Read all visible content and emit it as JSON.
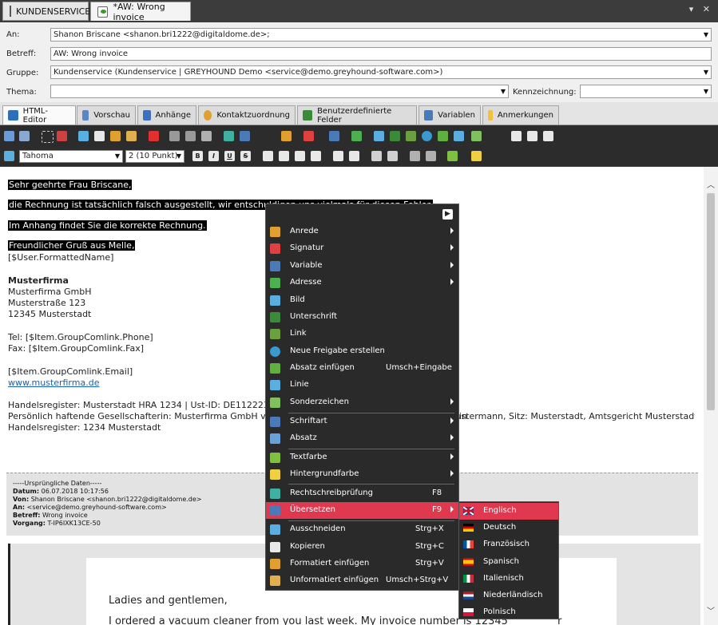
{
  "window": {
    "tabs": [
      {
        "label": "KUNDENSERVICE",
        "icon": "grid-icon"
      },
      {
        "label": "*AW: Wrong invoice",
        "icon": "email-icon"
      }
    ]
  },
  "form": {
    "an_label": "An:",
    "an_value": "Shanon Briscane <shanon.bri1222@digitaldome.de>;",
    "betreff_label": "Betreff:",
    "betreff_value": "AW: Wrong invoice",
    "gruppe_label": "Gruppe:",
    "gruppe_value": "Kundenservice (Kundenservice | GREYHOUND Demo <service@demo.greyhound-software.com>)",
    "thema_label": "Thema:",
    "thema_value": "",
    "kennz_label": "Kennzeichnung:",
    "kennz_value": ""
  },
  "ribbon_tabs": [
    {
      "label": "HTML-Editor",
      "icon": "html-editor-icon",
      "color": "#2f6fb7"
    },
    {
      "label": "Vorschau",
      "icon": "preview-icon",
      "color": "#5a86c5"
    },
    {
      "label": "Anhänge",
      "icon": "paperclip-icon",
      "color": "#3f6fbf"
    },
    {
      "label": "Kontaktzuordnung",
      "icon": "contact-icon",
      "color": "#e0a030"
    },
    {
      "label": "Benutzerdefinierte Felder",
      "icon": "custom-fields-icon",
      "color": "#3a8a3a"
    },
    {
      "label": "Variablen",
      "icon": "variables-icon",
      "color": "#4a7ab8"
    },
    {
      "label": "Anmerkungen",
      "icon": "notes-icon",
      "color": "#f0c040"
    }
  ],
  "toolbar": {
    "font_name": "Tahoma",
    "font_size": "2 (10 Punkt)",
    "format_buttons": [
      "B",
      "I",
      "U",
      "S"
    ]
  },
  "editor": {
    "lines": [
      {
        "text": "Sehr geehrte Frau Briscane,",
        "highlight": true
      },
      {
        "text": "die Rechnung ist tatsächlich falsch ausgestellt, wir entschuldigen uns vielmals für diesen Fehler.",
        "highlight": true
      },
      {
        "text": "Im Anhang findet Sie die korrekte Rechnung.",
        "highlight": true
      },
      {
        "text": "Freundlicher Gruß aus Melle,",
        "highlight": true
      },
      {
        "text": "[$User.FormattedName]",
        "highlight": false
      },
      {
        "text": "Musterfirma",
        "highlight": false,
        "bold": true
      },
      {
        "text": "Musterfirma GmbH",
        "highlight": false
      },
      {
        "text": "Musterstraße 123",
        "highlight": false
      },
      {
        "text": "12345 Musterstadt",
        "highlight": false
      },
      {
        "text": "Tel: [$Item.GroupComlink.Phone]",
        "highlight": false
      },
      {
        "text": "Fax: [$Item.GroupComlink.Fax]",
        "highlight": false
      },
      {
        "text": "[$Item.GroupComlink.Email]",
        "highlight": false
      },
      {
        "text": "www.musterfirma.de",
        "highlight": false,
        "link": true
      },
      {
        "text": "Handelsregister: Musterstadt HRA 1234 | Ust-ID: DE112223333",
        "highlight": false
      },
      {
        "text": "Persönlich haftende Gesellschafterin: Musterfirma GmbH vertreten durch den Geschäftsführer: Max Mustermann, Sitz: Musterstadt, Amtsgericht Musterstadt: Musterstadt, Amtsgericht Musterstadt HRB 1234, Sitz: Musterstadt, Amtsgericht Musterstadt Musterstadt, Amtsgericht Musterstadt HRB 1234, Sitz: Musterstadt, Amtsgericht Musterstadt Musterstadt, Amtsgericht Musterstadt HRB 1234, Sitz: Musterstadt, Amtsgericht Musterstadt HRB 1234, Sitz: Musterstadt, Amtsgericht Musterstadt HRB 1234, Sitz: Musterstadt, Amtsgericht Musterstadt HRB 1234, Sitz: Musterstadt, Amtsgericht Musterstadt HRB 1234, Sitz: Musterstadt, Amtsgericht Musterstadt HRB 1234, Sitz: Musterstadt, Amtsgericht Musterstadt HRB 1234, Sitz: Musterstadt, Amtsgericht Musterstadt HRB 1234, Sitz: Musterstadt, Amtsgericht Musterstadt HRB 1234, Sitz: Musterstadt, Amtsgericht Musterstadt HRB 1234, Sitz: Musterstadt, Amtsgericht Musterstadt HRB 1234, Sitz: Musterstadt, Amtsgericht Musterstadt HRB 1234, Sitz: Musterstadt, Amtsgericht Musterstadt HRB 1234, Sitz: Musterstadt, Amtsgericht Musterstadt HRB 1234, Sitz: Musterstadt, Amtsgericht Musterstadt HRB 1234, Sitz: Musterstadt, Amtsgericht Musterstadt HRB 1234, Sitz: Musterstadt, Amtsgericht Musterstadt HRB 1234, Sitz: Musterstadt, Amtsgericht Musterstadt HRB 1234, Sitz: Musterstadt, Amtsgericht Musterstadt HRB 1234, Sitz: Musterstadt, Amtsgericht Musterstadt HRB 1234, Sitz: Musterstadt, Amtsgericht Musterstadt HRB 1234 Sitz: Musterstadt, Amtsgericht Musterstadt: Musterstadt, Amtsgericht Musterstadt HRB 1234 Sitz: Musterstadt, Amtsgericht Musterstadt HRB 1234 Sitz: Musterstadt, Amtsgericht Musterstadt",
        "highlight": false
      },
      {
        "text": "Handelsregister: 1234 Musterstadt",
        "highlight": false
      }
    ],
    "visible_right_fragment": "in"
  },
  "quote": {
    "header": "-----Ursprüngliche Daten-----",
    "rows": [
      {
        "label": "Datum:",
        "value": "06.07.2018 10:17:56"
      },
      {
        "label": "Von:",
        "value": "Shanon Briscane <shanon.bri1222@digitaldome.de>"
      },
      {
        "label": "An:",
        "value": "<service@demo.greyhound-software.com>"
      },
      {
        "label": "Betreff:",
        "value": "Wrong invoice"
      },
      {
        "label": "Vorgang:",
        "value": "T-IP6IXK13CE-50"
      }
    ]
  },
  "inner_mail": {
    "greeting": "Ladies and gentlemen,",
    "line1": "I ordered a vacuum cleaner from you last week. My invoice number is 12345",
    "line1_tail": "r"
  },
  "context_menu": {
    "items": [
      {
        "label": "Anrede",
        "shortcut": "",
        "submenu": true,
        "icon": "salutation-icon",
        "color": "#e0a030"
      },
      {
        "label": "Signatur",
        "shortcut": "",
        "submenu": true,
        "icon": "signature-icon",
        "color": "#e04040"
      },
      {
        "label": "Variable",
        "shortcut": "",
        "submenu": true,
        "icon": "variable-icon",
        "color": "#4a7ab8"
      },
      {
        "label": "Adresse",
        "shortcut": "",
        "submenu": true,
        "icon": "address-icon",
        "color": "#4caf50"
      },
      {
        "label": "Bild",
        "shortcut": "",
        "submenu": false,
        "icon": "image-icon",
        "color": "#5aaee0"
      },
      {
        "label": "Unterschrift",
        "shortcut": "",
        "submenu": false,
        "icon": "handwriting-icon",
        "color": "#3a8a3a"
      },
      {
        "label": "Link",
        "shortcut": "",
        "submenu": false,
        "icon": "link-icon",
        "color": "#6aa040"
      },
      {
        "label": "Neue Freigabe erstellen",
        "shortcut": "",
        "submenu": false,
        "icon": "share-icon",
        "color": "#3a9ad0"
      },
      {
        "label": "Absatz einfügen",
        "shortcut": "Umsch+Eingabe",
        "submenu": false,
        "icon": "insert-paragraph-icon",
        "color": "#60b040"
      },
      {
        "label": "Linie",
        "shortcut": "",
        "submenu": false,
        "icon": "line-icon",
        "color": "#5aaee0"
      },
      {
        "label": "Sonderzeichen",
        "shortcut": "",
        "submenu": true,
        "icon": "special-chars-icon",
        "color": "#80c060"
      },
      {
        "label": "Schriftart",
        "shortcut": "",
        "submenu": true,
        "icon": "font-icon",
        "color": "#4a7ab8"
      },
      {
        "label": "Absatz",
        "shortcut": "",
        "submenu": true,
        "icon": "paragraph-icon",
        "color": "#6aa0d8"
      },
      {
        "label": "Textfarbe",
        "shortcut": "",
        "submenu": true,
        "icon": "text-color-icon",
        "color": "#80c040"
      },
      {
        "label": "Hintergrundfarbe",
        "shortcut": "",
        "submenu": true,
        "icon": "background-color-icon",
        "color": "#f0d040"
      },
      {
        "label": "Rechtschreibprüfung",
        "shortcut": "F8",
        "submenu": false,
        "icon": "spellcheck-icon",
        "color": "#40b0a0"
      },
      {
        "label": "Übersetzen",
        "shortcut": "F9",
        "submenu": true,
        "icon": "translate-icon",
        "color": "#4a7ab8",
        "selected": true
      },
      {
        "label": "Ausschneiden",
        "shortcut": "Strg+X",
        "submenu": false,
        "icon": "cut-icon",
        "color": "#5aaee0"
      },
      {
        "label": "Kopieren",
        "shortcut": "Strg+C",
        "submenu": false,
        "icon": "copy-icon",
        "color": "#e8e8e8"
      },
      {
        "label": "Formatiert einfügen",
        "shortcut": "Strg+V",
        "submenu": false,
        "icon": "paste-formatted-icon",
        "color": "#e0a030"
      },
      {
        "label": "Unformatiert einfügen",
        "shortcut": "Umsch+Strg+V",
        "submenu": false,
        "icon": "paste-plain-icon",
        "color": "#e0a030"
      }
    ]
  },
  "translate_submenu": {
    "items": [
      {
        "label": "Englisch",
        "flag": "uk-flag-icon",
        "selected": true
      },
      {
        "label": "Deutsch",
        "flag": "germany-flag-icon"
      },
      {
        "label": "Französisch",
        "flag": "france-flag-icon"
      },
      {
        "label": "Spanisch",
        "flag": "spain-flag-icon"
      },
      {
        "label": "Italienisch",
        "flag": "italy-flag-icon"
      },
      {
        "label": "Niederländisch",
        "flag": "netherlands-flag-icon"
      },
      {
        "label": "Polnisch",
        "flag": "poland-flag-icon"
      }
    ]
  }
}
